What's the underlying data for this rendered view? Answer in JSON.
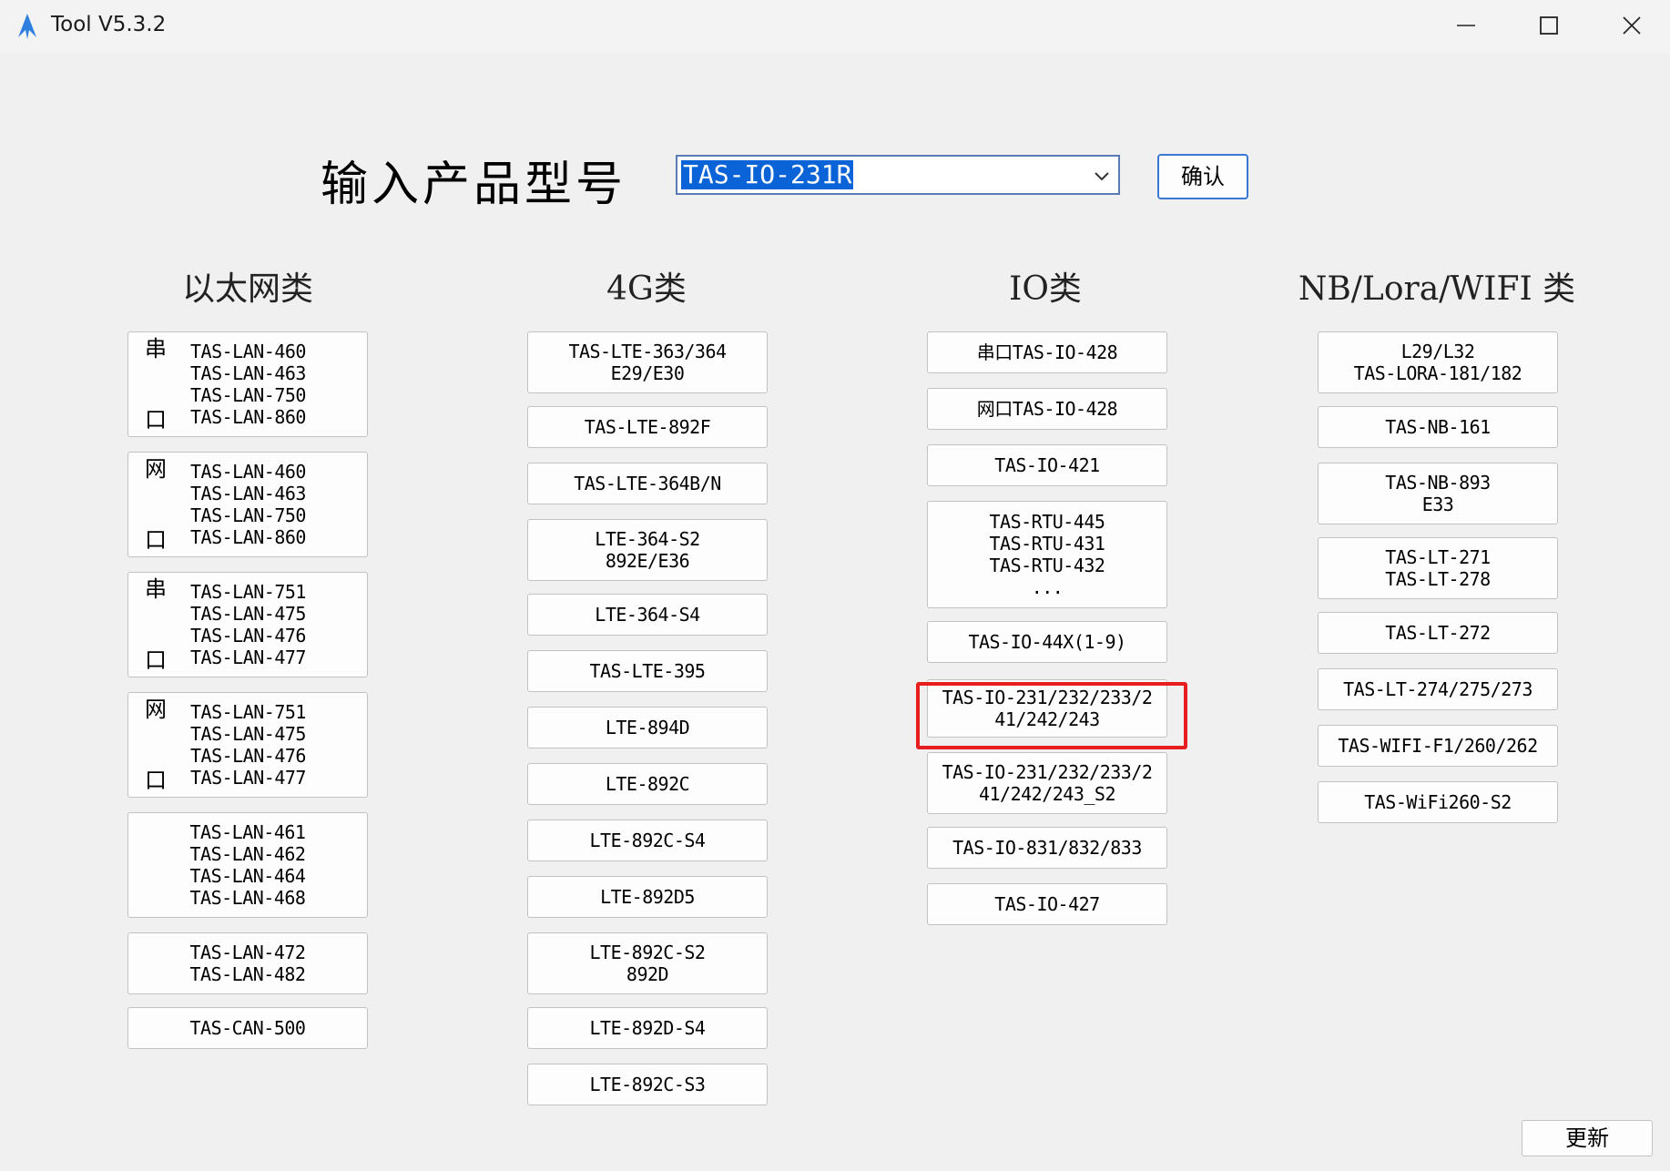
{
  "window": {
    "title": "Tool V5.3.2"
  },
  "prompt": {
    "label": "输入产品型号",
    "value": "TAS-IO-231R",
    "confirm_label": "确认"
  },
  "categories": {
    "ethernet": {
      "title": "以太网类",
      "buttons": [
        {
          "marks": [
            "串",
            "口"
          ],
          "lines": [
            "TAS-LAN-460",
            "TAS-LAN-463",
            "TAS-LAN-750",
            "TAS-LAN-860"
          ]
        },
        {
          "marks": [
            "网",
            "口"
          ],
          "lines": [
            "TAS-LAN-460",
            "TAS-LAN-463",
            "TAS-LAN-750",
            "TAS-LAN-860"
          ]
        },
        {
          "marks": [
            "串",
            "口"
          ],
          "lines": [
            "TAS-LAN-751",
            "TAS-LAN-475",
            "TAS-LAN-476",
            "TAS-LAN-477"
          ]
        },
        {
          "marks": [
            "网",
            "口"
          ],
          "lines": [
            "TAS-LAN-751",
            "TAS-LAN-475",
            "TAS-LAN-476",
            "TAS-LAN-477"
          ]
        },
        {
          "lines": [
            "TAS-LAN-461",
            "TAS-LAN-462",
            "TAS-LAN-464",
            "TAS-LAN-468"
          ]
        },
        {
          "lines": [
            "TAS-LAN-472",
            "TAS-LAN-482"
          ]
        },
        {
          "lines": [
            "TAS-CAN-500"
          ]
        }
      ]
    },
    "g4": {
      "title": "4G类",
      "buttons": [
        {
          "lines": [
            "TAS-LTE-363/364",
            "E29/E30"
          ]
        },
        {
          "lines": [
            "TAS-LTE-892F"
          ]
        },
        {
          "lines": [
            "TAS-LTE-364B/N"
          ]
        },
        {
          "lines": [
            "LTE-364-S2",
            "892E/E36"
          ]
        },
        {
          "lines": [
            "LTE-364-S4"
          ]
        },
        {
          "lines": [
            "TAS-LTE-395"
          ]
        },
        {
          "lines": [
            "LTE-894D"
          ]
        },
        {
          "lines": [
            "LTE-892C"
          ]
        },
        {
          "lines": [
            "LTE-892C-S4"
          ]
        },
        {
          "lines": [
            "LTE-892D5"
          ]
        },
        {
          "lines": [
            "LTE-892C-S2",
            "892D"
          ]
        },
        {
          "lines": [
            "LTE-892D-S4"
          ]
        },
        {
          "lines": [
            "LTE-892C-S3"
          ]
        }
      ]
    },
    "io": {
      "title": "IO类",
      "buttons": [
        {
          "lines": [
            "串口TAS-IO-428"
          ]
        },
        {
          "lines": [
            "网口TAS-IO-428"
          ]
        },
        {
          "lines": [
            "TAS-IO-421"
          ]
        },
        {
          "lines": [
            "TAS-RTU-445",
            "TAS-RTU-431",
            "TAS-RTU-432",
            "..."
          ]
        },
        {
          "lines": [
            "TAS-IO-44X(1-9)"
          ]
        },
        {
          "lines": [
            "TAS-IO-231/232/233/2",
            "41/242/243"
          ]
        },
        {
          "lines": [
            "TAS-IO-231/232/233/2",
            "41/242/243_S2"
          ]
        },
        {
          "lines": [
            "TAS-IO-831/832/833"
          ]
        },
        {
          "lines": [
            "TAS-IO-427"
          ]
        }
      ]
    },
    "wireless": {
      "title": "NB/Lora/WIFI 类",
      "buttons": [
        {
          "lines": [
            "L29/L32",
            "TAS-LORA-181/182"
          ]
        },
        {
          "lines": [
            "TAS-NB-161"
          ]
        },
        {
          "lines": [
            "TAS-NB-893",
            "E33"
          ]
        },
        {
          "lines": [
            "TAS-LT-271",
            "TAS-LT-278"
          ]
        },
        {
          "lines": [
            "TAS-LT-272"
          ]
        },
        {
          "lines": [
            "TAS-LT-274/275/273"
          ]
        },
        {
          "lines": [
            "TAS-WIFI-F1/260/262"
          ]
        },
        {
          "lines": [
            "TAS-WiFi260-S2"
          ]
        }
      ]
    }
  },
  "update_label": "更新",
  "colors": {
    "highlight": "#e81e1e",
    "selection": "#0a64d8",
    "accent": "#3a78d4"
  }
}
